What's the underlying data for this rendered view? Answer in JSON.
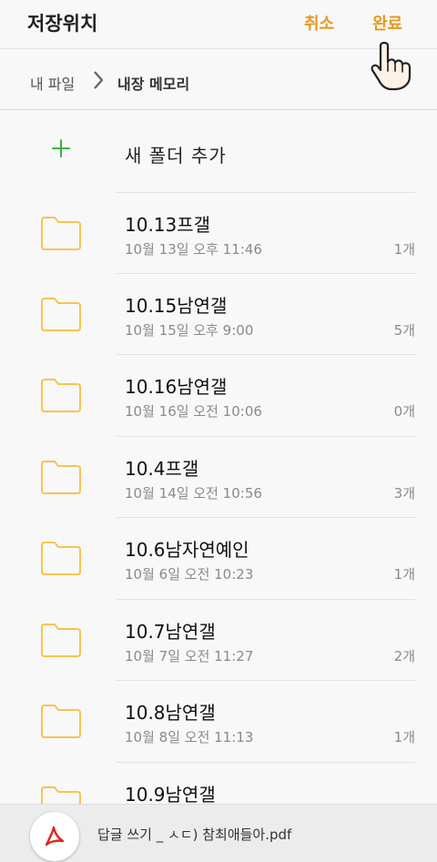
{
  "header": {
    "title": "저장위치",
    "cancel_label": "취소",
    "done_label": "완료"
  },
  "breadcrumb": {
    "root": "내 파일",
    "current": "내장 메모리"
  },
  "new_folder": {
    "label": "새 폴더 추가"
  },
  "folders": [
    {
      "name": "10.13프갤",
      "date": "10월 13일 오후 11:46",
      "count": "1개"
    },
    {
      "name": "10.15남연갤",
      "date": "10월 15일 오후 9:00",
      "count": "5개"
    },
    {
      "name": "10.16남연갤",
      "date": "10월 16일 오전 10:06",
      "count": "0개"
    },
    {
      "name": "10.4프갤",
      "date": "10월 14일 오전 10:56",
      "count": "3개"
    },
    {
      "name": "10.6남자연예인",
      "date": "10월 6일 오전 10:23",
      "count": "1개"
    },
    {
      "name": "10.7남연갤",
      "date": "10월 7일 오전 11:27",
      "count": "2개"
    },
    {
      "name": "10.8남연갤",
      "date": "10월 8일 오전 11:13",
      "count": "1개"
    },
    {
      "name": "10.9남연갤",
      "date": "",
      "count": ""
    }
  ],
  "bottom_file": {
    "icon": "pdf-icon",
    "name": "답글 쓰기 _ ㅅㄷ) 참최애들아.pdf"
  },
  "colors": {
    "accent": "#e6981a",
    "folder_outline": "#f6c451",
    "plus": "#3cb043",
    "pdf_red": "#e0261b"
  }
}
